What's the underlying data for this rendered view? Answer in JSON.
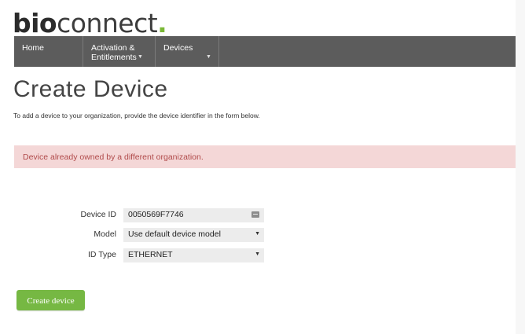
{
  "brand": {
    "logo_bold": "bio",
    "logo_light": "connect",
    "logo_dot": "."
  },
  "nav": {
    "items": [
      {
        "label": "Home"
      },
      {
        "label_line1": "Activation &",
        "label_line2": "Entitlements"
      },
      {
        "label": "Devices"
      }
    ]
  },
  "page": {
    "title": "Create Device",
    "intro": "To add a device to your organization, provide the device identifier in the form below."
  },
  "alert": {
    "message": "Device already owned by a different organization."
  },
  "form": {
    "device_id_label": "Device ID",
    "device_id_value": "0050569F7746",
    "model_label": "Model",
    "model_value": "Use default device model",
    "id_type_label": "ID Type",
    "id_type_value": "ETHERNET",
    "submit_label": "Create device"
  },
  "colors": {
    "nav_bg": "#5c5c5c",
    "accent_green": "#76b843",
    "alert_bg": "#f4d7d7",
    "alert_text": "#b04a4a"
  },
  "icons": {
    "device_id_field": "keyboard-icon",
    "dropdown": "chevron-down-icon"
  }
}
